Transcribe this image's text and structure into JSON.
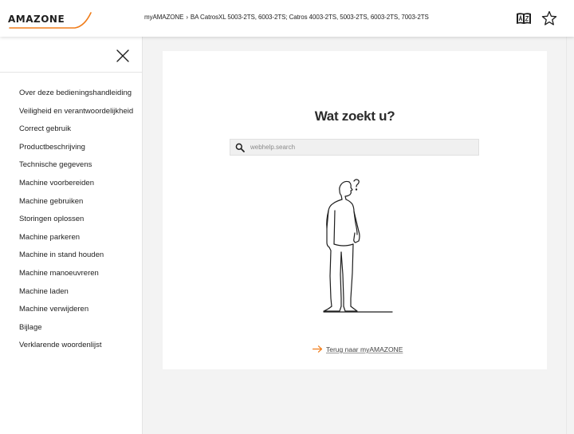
{
  "header": {
    "logo_text": "AMAZONE",
    "breadcrumb": {
      "root": "myAMAZONE",
      "separator": "›",
      "current": "BA CatrosXL 5003-2TS, 6003-2TS; Catros 4003-2TS, 5003-2TS, 6003-2TS, 7003-2TS"
    },
    "icons": [
      "language-book-icon",
      "star-icon"
    ]
  },
  "sidebar": {
    "close_icon": "close-icon",
    "items": [
      "Over deze bedieningshandleiding",
      "Veiligheid en verantwoordelijkheid",
      "Correct gebruik",
      "Productbeschrijving",
      "Technische gegevens",
      "Machine voorbereiden",
      "Machine gebruiken",
      "Storingen oplossen",
      "Machine parkeren",
      "Machine in stand houden",
      "Machine manoeuvreren",
      "Machine laden",
      "Machine verwijderen",
      "Bijlage",
      "Verklarende woordenlijst"
    ]
  },
  "main": {
    "title": "Wat zoekt u?",
    "search": {
      "placeholder": "webhelp.search",
      "value": ""
    },
    "back_link": "Terug naar myAMAZONE"
  },
  "colors": {
    "accent": "#f07d1a",
    "text": "#1e1e1e",
    "background": "#f3f3f3"
  }
}
